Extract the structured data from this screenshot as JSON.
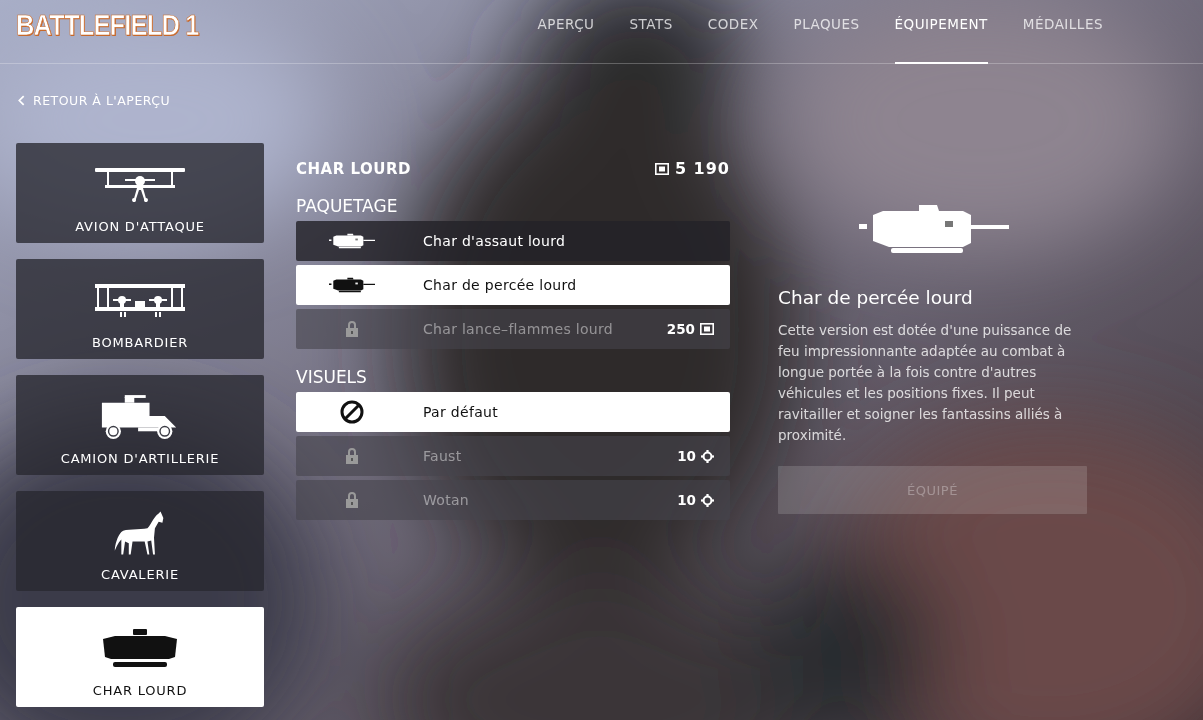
{
  "logo": "BATTLEFIELD 1",
  "nav": [
    {
      "label": "APERÇU",
      "selected": false
    },
    {
      "label": "STATS",
      "selected": false
    },
    {
      "label": "CODEX",
      "selected": false
    },
    {
      "label": "PLAQUES",
      "selected": false
    },
    {
      "label": "ÉQUIPEMENT",
      "selected": true
    },
    {
      "label": "MÉDAILLES",
      "selected": false
    }
  ],
  "back_link": "RETOUR À L'APERÇU",
  "vehicles": [
    {
      "label": "AVION D'ATTAQUE",
      "kind": "plane",
      "selected": false
    },
    {
      "label": "BOMBARDIER",
      "kind": "bomber",
      "selected": false
    },
    {
      "label": "CAMION D'ARTILLERIE",
      "kind": "truck",
      "selected": false
    },
    {
      "label": "CAVALERIE",
      "kind": "horse",
      "selected": false
    },
    {
      "label": "CHAR LOURD",
      "kind": "tank",
      "selected": true
    }
  ],
  "item": {
    "title": "CHAR LOURD",
    "balance": "5 190"
  },
  "sections": [
    {
      "title": "PAQUETAGE",
      "items": [
        {
          "label": "Char d'assaut lourd",
          "kind": "tank",
          "locked": false,
          "selected": false
        },
        {
          "label": "Char de percée lourd",
          "kind": "tank",
          "locked": false,
          "selected": true
        },
        {
          "label": "Char lance–flammes lourd",
          "kind": "lock",
          "locked": true,
          "selected": false,
          "price": {
            "amount": "250",
            "kind": "bond"
          }
        }
      ]
    },
    {
      "title": "VISUELS",
      "items": [
        {
          "label": "Par défaut",
          "kind": "none",
          "locked": false,
          "selected": true
        },
        {
          "label": "Faust",
          "kind": "lock",
          "locked": true,
          "selected": false,
          "price": {
            "amount": "10",
            "kind": "part"
          }
        },
        {
          "label": "Wotan",
          "kind": "lock",
          "locked": true,
          "selected": false,
          "price": {
            "amount": "10",
            "kind": "part"
          }
        }
      ]
    }
  ],
  "detail": {
    "title": "Char de percée lourd",
    "description": "Cette version est dotée d'une puissance de feu impressionnante adaptée au combat à longue portée à la fois contre d'autres véhicules et les positions fixes. Il peut ravitailler et soigner les fantassins alliés à proximité.",
    "button": {
      "label": "ÉQUIPÉ",
      "disabled": true
    }
  }
}
